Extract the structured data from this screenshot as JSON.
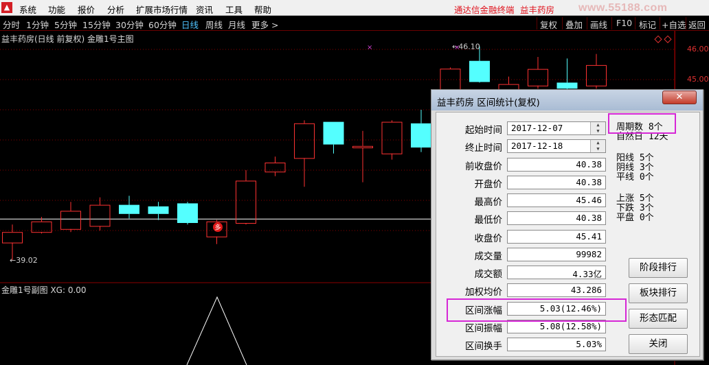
{
  "menu": {
    "items": [
      "系统",
      "功能",
      "报价",
      "分析",
      "扩展市场行情",
      "资讯",
      "工具",
      "帮助"
    ],
    "promo_terminal": "通达信金融终端",
    "promo_stock": "益丰药房",
    "watermark": "www.55188.com"
  },
  "periods": [
    "分时",
    "1分钟",
    "5分钟",
    "15分钟",
    "30分钟",
    "60分钟",
    "日线",
    "周线",
    "月线",
    "更多 >"
  ],
  "active_period": "日线",
  "toolbar": [
    "复权",
    "叠加",
    "画线",
    "F10",
    "标记",
    "+自选",
    "返回"
  ],
  "chart": {
    "title": "益丰药房(日线 前复权) 金雕1号主图",
    "sub_title": "金雕1号副图 XG: 0.00",
    "price_axis": [
      "46.00",
      "45.00"
    ],
    "high_marker": "46.10",
    "low_marker": "39.02",
    "signal_badge": "多",
    "colors": {
      "up": "#ff3232",
      "down": "#54ffff",
      "grid": "#8b0000",
      "background": "#000000"
    }
  },
  "chart_data": {
    "type": "candlestick",
    "title": "益丰药房(日线 前复权) 金雕1号主图",
    "ylabels": [
      "46.00",
      "45.00"
    ],
    "annotations": [
      "46.10",
      "39.02",
      "多"
    ],
    "candles": [
      {
        "o": 39.6,
        "c": 39.95,
        "h": 40.2,
        "l": 39.02
      },
      {
        "o": 39.95,
        "c": 40.3,
        "h": 40.45,
        "l": 39.9
      },
      {
        "o": 40.05,
        "c": 40.65,
        "h": 40.95,
        "l": 39.95
      },
      {
        "o": 40.15,
        "c": 40.85,
        "h": 41.1,
        "l": 40.0
      },
      {
        "o": 40.85,
        "c": 40.55,
        "h": 41.15,
        "l": 40.4
      },
      {
        "o": 40.8,
        "c": 40.55,
        "h": 40.95,
        "l": 40.35
      },
      {
        "o": 40.9,
        "c": 40.25,
        "h": 40.95,
        "l": 40.2
      },
      {
        "o": 39.8,
        "c": 40.3,
        "h": 40.35,
        "l": 39.55
      },
      {
        "o": 40.25,
        "c": 41.65,
        "h": 42.0,
        "l": 40.2
      },
      {
        "o": 41.95,
        "c": 42.25,
        "h": 42.45,
        "l": 41.8
      },
      {
        "o": 42.4,
        "c": 43.55,
        "h": 43.65,
        "l": 41.45
      },
      {
        "o": 43.6,
        "c": 42.85,
        "h": 43.6,
        "l": 42.55
      },
      {
        "o": 42.75,
        "c": 42.8,
        "h": 43.3,
        "l": 41.6
      },
      {
        "o": 42.55,
        "c": 43.6,
        "h": 43.65,
        "l": 42.35
      },
      {
        "o": 43.55,
        "c": 42.75,
        "h": 44.0,
        "l": 42.6
      },
      {
        "o": 43.35,
        "c": 45.36,
        "h": 45.4,
        "l": 43.3
      },
      {
        "o": 45.62,
        "c": 44.92,
        "h": 46.1,
        "l": 44.9
      },
      {
        "o": 44.1,
        "c": 44.85,
        "h": 45.1,
        "l": 43.9
      },
      {
        "o": 44.8,
        "c": 45.35,
        "h": 45.75,
        "l": 44.7
      },
      {
        "o": 44.9,
        "c": 44.7,
        "h": 45.7,
        "l": 44.55
      },
      {
        "o": 44.8,
        "c": 45.48,
        "h": 45.85,
        "l": 44.7
      }
    ]
  },
  "dialog": {
    "title": "益丰药房 区间统计(复权)",
    "close_icon": "✕",
    "fields": [
      {
        "label": "起始时间",
        "value": "2017-12-07"
      },
      {
        "label": "终止时间",
        "value": "2017-12-18"
      },
      {
        "label": "前收盘价",
        "value": "40.38"
      },
      {
        "label": "开盘价",
        "value": "40.38"
      },
      {
        "label": "最高价",
        "value": "45.46"
      },
      {
        "label": "最低价",
        "value": "40.38"
      },
      {
        "label": "收盘价",
        "value": "45.41"
      },
      {
        "label": "成交量",
        "value": "99982"
      },
      {
        "label": "成交额",
        "value": "4.33亿"
      },
      {
        "label": "加权均价",
        "value": "43.286"
      },
      {
        "label": "区间涨幅",
        "value": "5.03(12.46%)"
      },
      {
        "label": "区间振幅",
        "value": "5.08(12.58%)"
      },
      {
        "label": "区间换手",
        "value": "5.03%"
      }
    ],
    "stats": {
      "period_count": "周期数 8个",
      "natural_days": "自然日 12天",
      "yang": "阳线 5个",
      "yin": "阴线 3个",
      "flat_line": "平线 0个",
      "rise": "上涨 5个",
      "fall": "下跌 3个",
      "flat": "平盘 0个"
    },
    "buttons": [
      "阶段排行",
      "板块排行",
      "形态匹配",
      "关闭"
    ]
  }
}
